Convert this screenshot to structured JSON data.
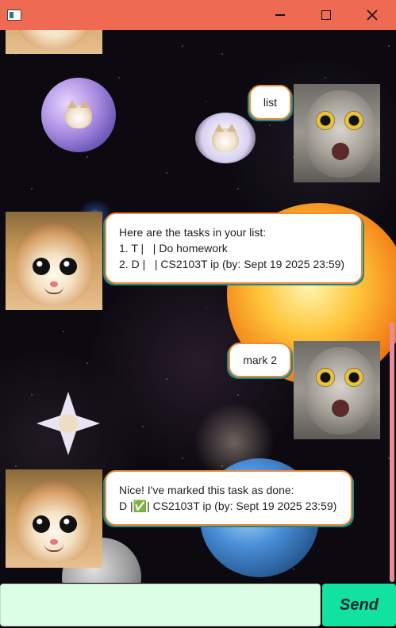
{
  "window": {
    "title": "",
    "icons": {
      "app": "app-icon",
      "minimize": "minimize-icon",
      "maximize": "maximize-icon",
      "close": "close-icon"
    }
  },
  "messages": [
    {
      "sender": "user",
      "avatar": "shocked-cat-avatar",
      "text": "list"
    },
    {
      "sender": "bot",
      "avatar": "smiling-cat-avatar",
      "lines": [
        "Here are the tasks in your list:",
        "1. T |   | Do homework",
        "2. D |   | CS2103T ip (by: Sept 19 2025 23:59)"
      ]
    },
    {
      "sender": "user",
      "avatar": "shocked-cat-avatar",
      "text": "mark 2"
    },
    {
      "sender": "bot",
      "avatar": "smiling-cat-avatar",
      "lines": [
        "Nice! I've marked this task as done:",
        "D |✅| CS2103T ip (by: Sept 19 2025 23:59)"
      ]
    }
  ],
  "input": {
    "value": "",
    "placeholder": ""
  },
  "send_button": {
    "label": "Send"
  },
  "colors": {
    "title_bar": "#ef6a52",
    "input_bg": "#dcfde6",
    "send_bg": "#11e2a0",
    "bubble_border": "#f08a3a",
    "bubble_shadow": "#1a8a8a",
    "scrollbar": "#e88a9a"
  }
}
